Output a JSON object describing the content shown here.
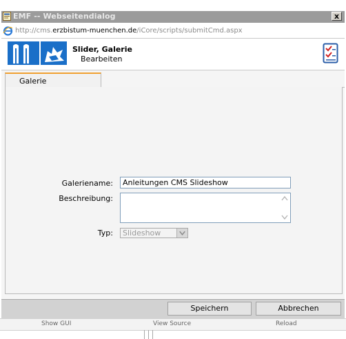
{
  "window": {
    "title": "EMF -- Webseitendialog",
    "close_glyph": "x"
  },
  "address": {
    "url_prefix": "http://cms.",
    "url_domain": "erzbistum-muenchen.de",
    "url_path": "/iCore/scripts/submitCmd.aspx"
  },
  "header": {
    "title": "Slider, Galerie",
    "subtitle": "Bearbeiten"
  },
  "tabs": [
    {
      "label": "Galerie",
      "active": true
    }
  ],
  "form": {
    "name_label": "Galeriename:",
    "name_value": "Anleitungen CMS Slideshow",
    "description_label": "Beschreibung:",
    "description_value": "",
    "type_label": "Typ:",
    "type_value": "Slideshow"
  },
  "footer": {
    "save_label": "Speichern",
    "cancel_label": "Abbrechen"
  },
  "statusbar": {
    "show_gui": "Show GUI",
    "view_source": "View Source",
    "reload": "Reload"
  },
  "colors": {
    "title_strip": "#9b9b9b",
    "tab_accent": "#f0a030",
    "logo_blue": "#1a6fc8",
    "checkbook_blue": "#2b5ea8"
  }
}
